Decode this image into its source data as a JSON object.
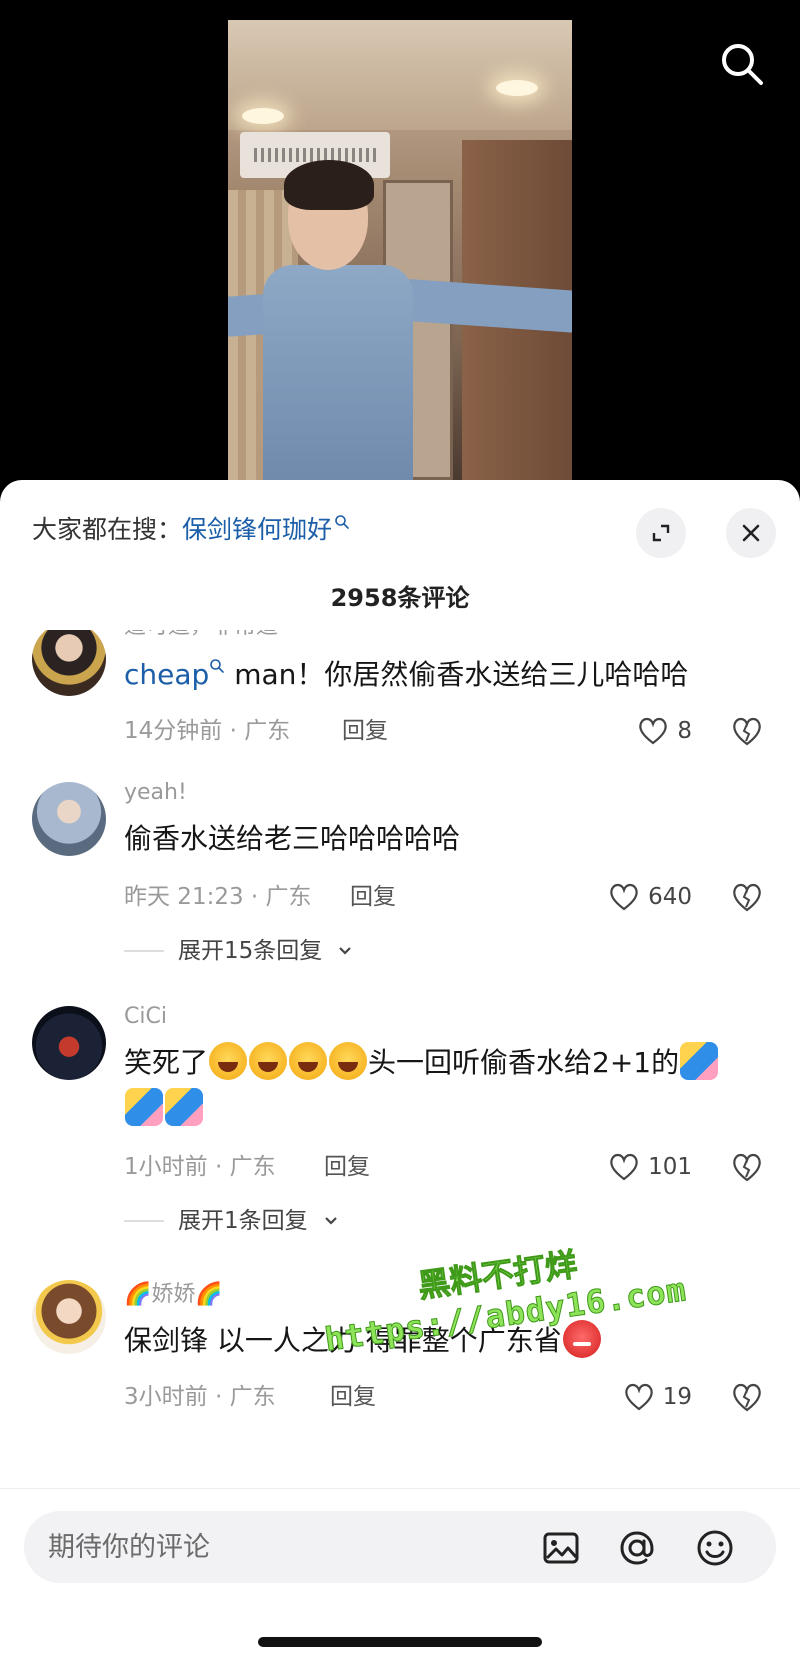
{
  "video": {
    "search_icon": "search-icon"
  },
  "sheet": {
    "hot_search_label": "大家都在搜：",
    "hot_search_link": "保剑锋何珈好",
    "expand_icon": "expand-icon",
    "close_icon": "close-icon",
    "comment_count": "2958条评论"
  },
  "comments": [
    {
      "name": "道可道，非常道",
      "mention": "cheap",
      "text": " man！你居然偷香水送给三儿哈哈哈",
      "time": "14分钟前 · 广东",
      "reply_label": "回复",
      "likes": "8"
    },
    {
      "name": "yeah!",
      "text": "偷香水送给老三哈哈哈哈哈",
      "time": "昨天 21:23 · 广东",
      "reply_label": "回复",
      "likes": "640",
      "expand": "展开15条回复"
    },
    {
      "name": "CiCi",
      "text_a": "笑死了",
      "text_b": "头一回听偷香水给2+1的",
      "time": "1小时前 · 广东",
      "reply_label": "回复",
      "likes": "101",
      "expand": "展开1条回复"
    },
    {
      "name": "🌈娇娇🌈",
      "text": "保剑锋  以一人之力  得罪整个广东省",
      "time": "3小时前 · 广东",
      "reply_label": "回复",
      "likes": "19"
    }
  ],
  "watermark": {
    "line1": "黑料不打烊",
    "line2": "https://abdy16.com"
  },
  "composer": {
    "placeholder": "期待你的评论",
    "image_icon": "image-icon",
    "mention_icon": "at-mention-icon",
    "emoji_icon": "emoji-icon"
  },
  "colors": {
    "link": "#1d5ea8",
    "meta": "#9a9a9a",
    "sheet_bg": "#ffffff"
  }
}
